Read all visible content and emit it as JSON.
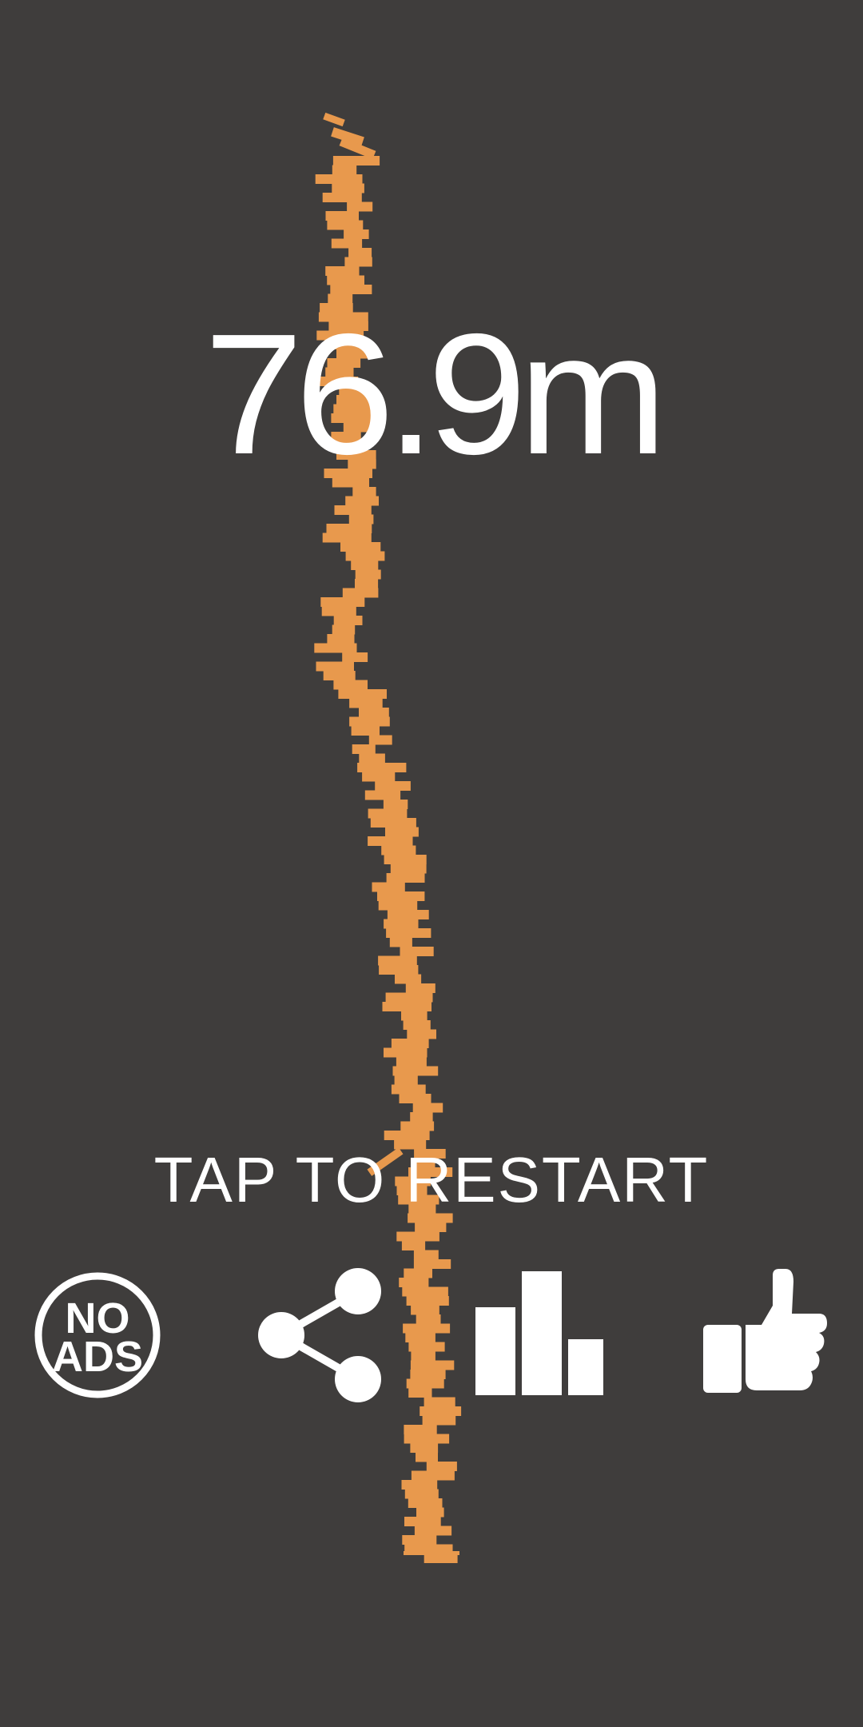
{
  "game": {
    "score_text": "76.9m",
    "restart_text": "TAP TO RESTART"
  },
  "buttons": {
    "no_ads": {
      "line1": "NO",
      "line2": "ADS",
      "icon": "no-ads-icon"
    },
    "share": {
      "icon": "share-icon"
    },
    "leaderboard": {
      "icon": "leaderboard-icon"
    },
    "like": {
      "icon": "thumbs-up-icon"
    }
  },
  "colors": {
    "background": "#3f3d3c",
    "tower": "#e8994d",
    "text": "#ffffff"
  }
}
